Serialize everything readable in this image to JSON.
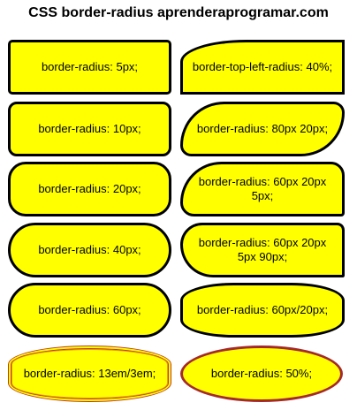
{
  "title": "CSS border-radius aprenderaprogramar.com",
  "boxes": [
    {
      "label": "border-radius: 5px;"
    },
    {
      "label": "border-top-left-radius: 40%;"
    },
    {
      "label": "border-radius: 10px;"
    },
    {
      "label": "border-radius: 80px 20px;"
    },
    {
      "label": "border-radius: 20px;"
    },
    {
      "label": "border-radius: 60px 20px 5px;"
    },
    {
      "label": "border-radius: 40px;"
    },
    {
      "label": "border-radius: 60px 20px 5px 90px;"
    },
    {
      "label": "border-radius: 60px;"
    },
    {
      "label": "border-radius: 60px/20px;"
    },
    {
      "label": "border-radius: 13em/3em;"
    },
    {
      "label": "border-radius: 50%;"
    }
  ],
  "colors": {
    "box_fill": "#ffff00",
    "border": "#000000",
    "accent_border": "#a52a2a"
  }
}
